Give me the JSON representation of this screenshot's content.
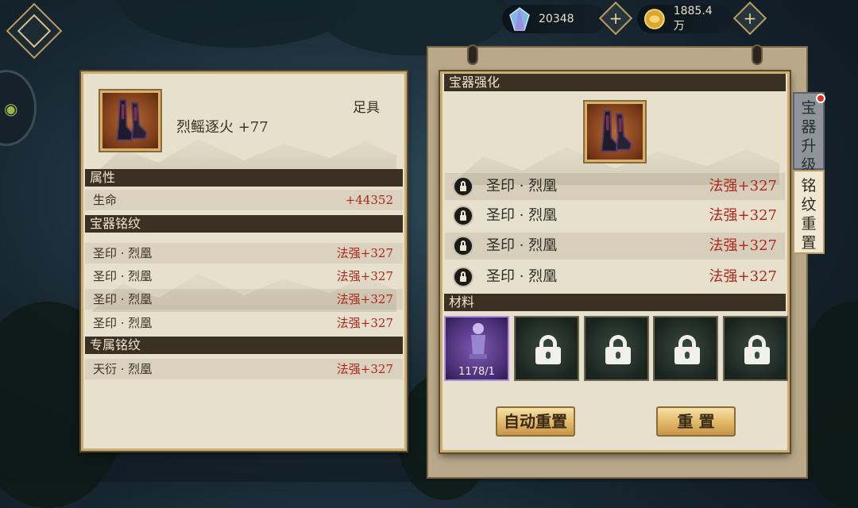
{
  "currency": {
    "gems": "20348",
    "gold": "1885.4万",
    "plus_symbol": "+"
  },
  "left": {
    "item_name": "烈鳐逐火 +77",
    "slot_type": "足具",
    "sections": {
      "attributes": "属性",
      "treasure_runes": "宝器铭纹",
      "exclusive_runes": "专属铭纹"
    },
    "attributes": [
      {
        "label": "生命",
        "value": "+44352"
      }
    ],
    "treasure_runes": [
      {
        "label": "圣印 · 烈凰",
        "value": "法强+327"
      },
      {
        "label": "圣印 · 烈凰",
        "value": "法强+327"
      },
      {
        "label": "圣印 · 烈凰",
        "value": "法强+327"
      },
      {
        "label": "圣印 · 烈凰",
        "value": "法强+327"
      }
    ],
    "exclusive_runes": [
      {
        "label": "天衍 · 烈凰",
        "value": "法强+327"
      }
    ]
  },
  "right": {
    "header": "宝器强化",
    "runes": [
      {
        "label": "圣印 · 烈凰",
        "value": "法强+327"
      },
      {
        "label": "圣印 · 烈凰",
        "value": "法强+327"
      },
      {
        "label": "圣印 · 烈凰",
        "value": "法强+327"
      },
      {
        "label": "圣印 · 烈凰",
        "value": "法强+327"
      }
    ],
    "materials_header": "材料",
    "material_count": "1178/1",
    "auto_reset_label": "自动重置",
    "reset_label": "重 置"
  },
  "tabs": {
    "upgrade": "宝器升级",
    "reset": "铭纹重置"
  },
  "colors": {
    "value_red": "#b0261c",
    "panel_bg": "#e7e0cd",
    "section_bar": "#3a3024",
    "gold_button": "#e1b867"
  }
}
